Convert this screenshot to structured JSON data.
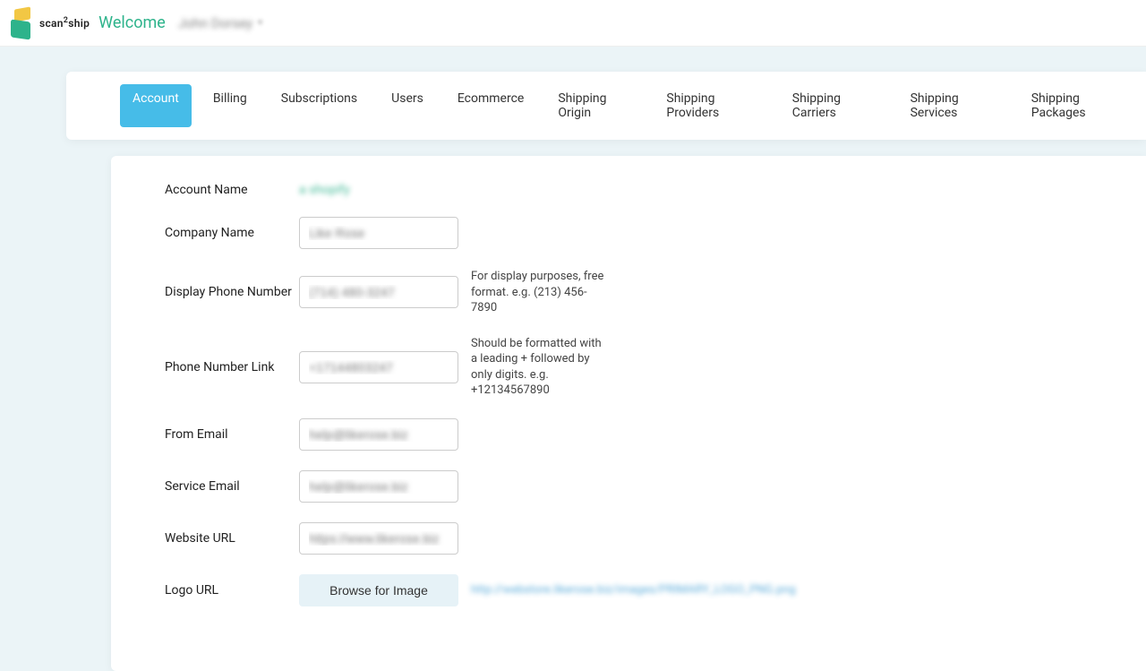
{
  "header": {
    "brand": "scan²ship",
    "welcome": "Welcome",
    "username": "John Dorsey"
  },
  "tabs": [
    {
      "label": "Account",
      "active": true
    },
    {
      "label": "Billing"
    },
    {
      "label": "Subscriptions"
    },
    {
      "label": "Users"
    },
    {
      "label": "Ecommerce"
    },
    {
      "label": "Shipping Origin"
    },
    {
      "label": "Shipping Providers"
    },
    {
      "label": "Shipping Carriers"
    },
    {
      "label": "Shipping Services"
    },
    {
      "label": "Shipping Packages"
    }
  ],
  "form": {
    "account_name": {
      "label": "Account Name",
      "value": "a shopify"
    },
    "company_name": {
      "label": "Company Name",
      "value": "Like Rose"
    },
    "display_phone": {
      "label": "Display Phone Number",
      "value": "(714) 480-3247",
      "hint": "For display purposes, free format. e.g. (213) 456-7890"
    },
    "phone_link": {
      "label": "Phone Number Link",
      "value": "+17144803247",
      "hint": "Should be formatted with a leading + followed by only digits. e.g. +12134567890"
    },
    "from_email": {
      "label": "From Email",
      "value": "help@likerose.biz"
    },
    "service_email": {
      "label": "Service Email",
      "value": "help@likerose.biz"
    },
    "website_url": {
      "label": "Website URL",
      "value": "https://www.likerose.biz"
    },
    "logo_url": {
      "label": "Logo URL",
      "button": "Browse for Image",
      "text": "http://webstore.likerose.biz/images/PRIMARY_LOGO_PNG.png"
    }
  }
}
